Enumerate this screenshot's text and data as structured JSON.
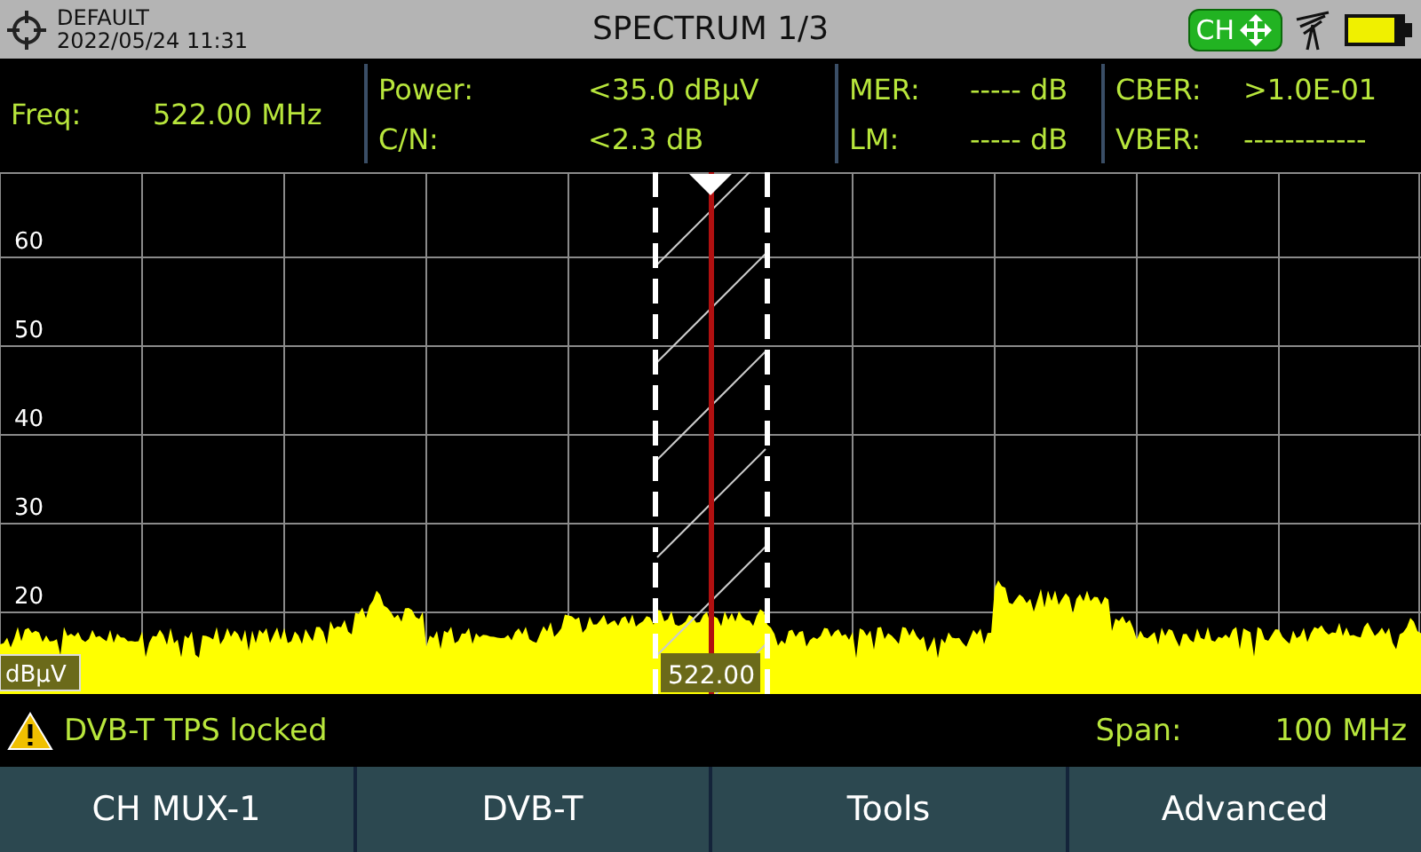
{
  "header": {
    "profile": "DEFAULT",
    "datetime": "2022/05/24 11:31",
    "title": "SPECTRUM 1/3",
    "mode_badge": "CH"
  },
  "measurements": [
    {
      "rows": [
        {
          "label": "Freq:",
          "value": "522.00 MHz"
        }
      ]
    },
    {
      "rows": [
        {
          "label": "Power:",
          "value": "<35.0 dBµV"
        },
        {
          "label": "C/N:",
          "value": "<2.3 dB"
        }
      ]
    },
    {
      "rows": [
        {
          "label": "MER:",
          "value": "----- dB"
        },
        {
          "label": "LM:",
          "value": "----- dB"
        }
      ]
    },
    {
      "rows": [
        {
          "label": "CBER:",
          "value": ">1.0E-01"
        },
        {
          "label": "VBER:",
          "value": "------------"
        }
      ]
    }
  ],
  "spectrum": {
    "y_labels": [
      "60",
      "50",
      "40",
      "30",
      "20"
    ],
    "unit": "dBµV",
    "marker_label": "522.00"
  },
  "status": {
    "message": "DVB-T TPS locked",
    "span_label": "Span:",
    "span_value": "100 MHz"
  },
  "buttons": [
    "CH MUX-1",
    "DVB-T",
    "Tools",
    "Advanced"
  ]
}
